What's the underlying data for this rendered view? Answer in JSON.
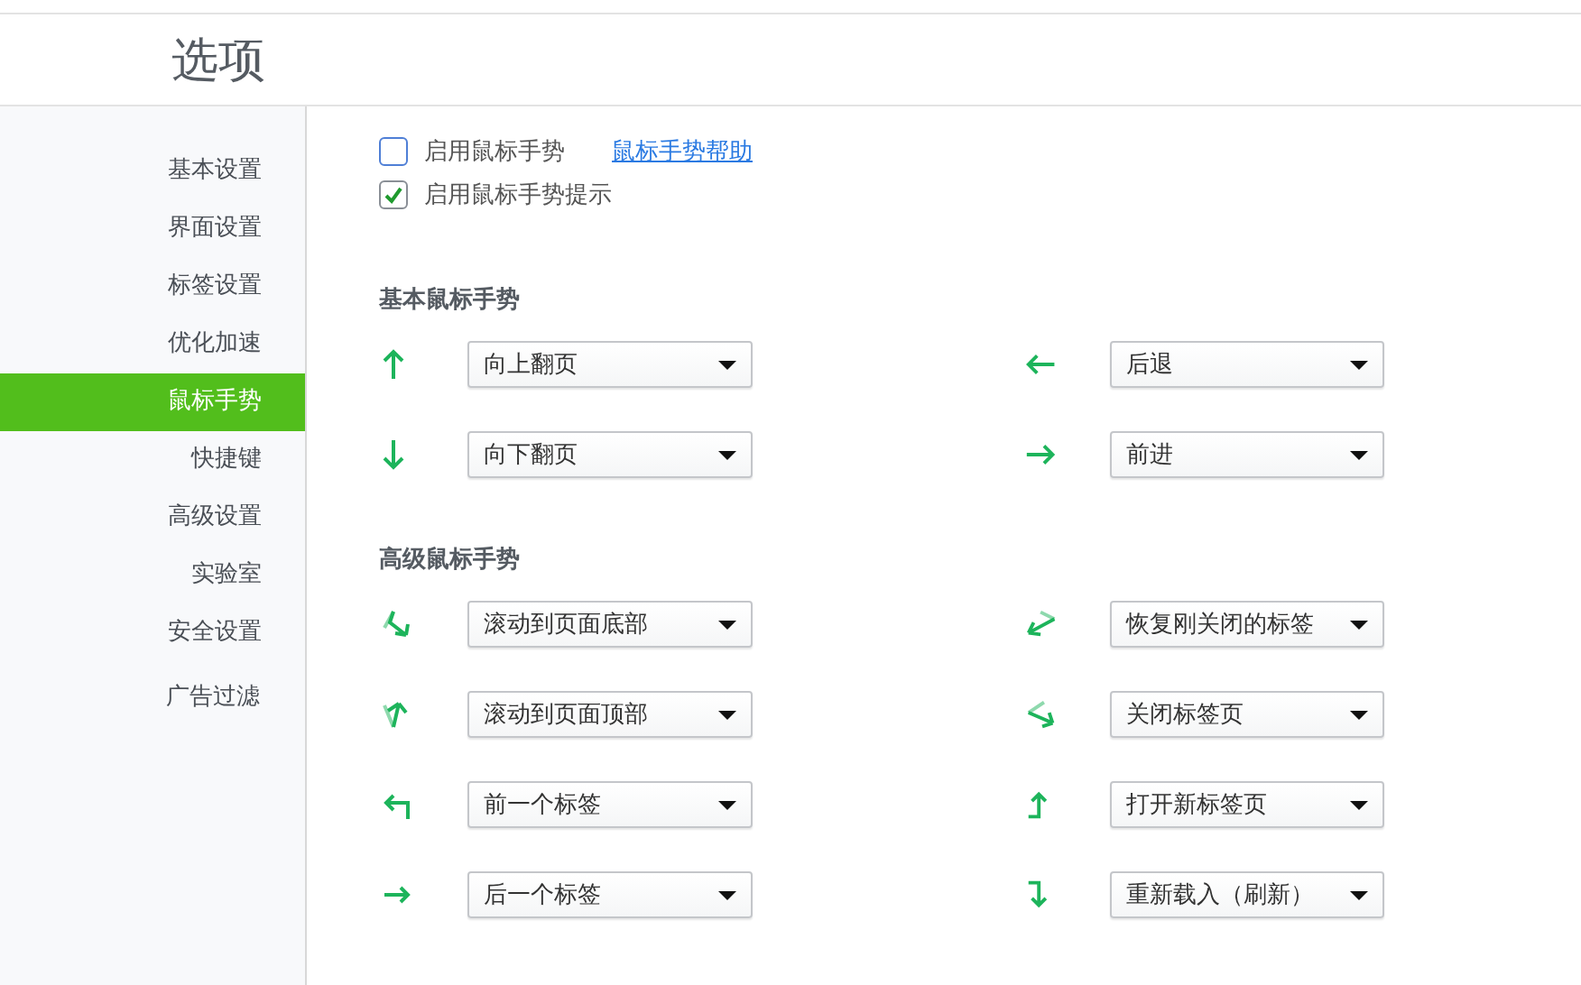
{
  "page_title": "选项",
  "sidebar": {
    "items": [
      {
        "label": "基本设置",
        "selected": false
      },
      {
        "label": "界面设置",
        "selected": false
      },
      {
        "label": "标签设置",
        "selected": false
      },
      {
        "label": "优化加速",
        "selected": false
      },
      {
        "label": "鼠标手势",
        "selected": true
      },
      {
        "label": "快捷键",
        "selected": false
      },
      {
        "label": "高级设置",
        "selected": false
      },
      {
        "label": "实验室",
        "selected": false
      },
      {
        "label": "安全设置",
        "selected": false
      },
      {
        "label": "广告过滤",
        "selected": false
      }
    ]
  },
  "options": [
    {
      "label": "启用鼠标手势",
      "checked": false,
      "link": "鼠标手势帮助"
    },
    {
      "label": "启用鼠标手势提示",
      "checked": true
    }
  ],
  "sections": [
    {
      "title": "基本鼠标手势",
      "gestures": [
        {
          "kind": "up",
          "action": "向上翻页"
        },
        {
          "kind": "left",
          "action": "后退"
        },
        {
          "kind": "down",
          "action": "向下翻页"
        },
        {
          "kind": "right",
          "action": "前进"
        }
      ]
    },
    {
      "title": "高级鼠标手势",
      "gestures": [
        {
          "kind": "zigzag-down",
          "action": "滚动到页面底部"
        },
        {
          "kind": "zigzag-left",
          "action": "恢复刚关闭的标签"
        },
        {
          "kind": "zigzag-up",
          "action": "滚动到页面顶部"
        },
        {
          "kind": "zigzag-right",
          "action": "关闭标签页"
        },
        {
          "kind": "turn-left",
          "action": "前一个标签"
        },
        {
          "kind": "turn-up",
          "action": "打开新标签页"
        },
        {
          "kind": "turn-right",
          "action": "后一个标签"
        },
        {
          "kind": "turn-down",
          "action": "重新载入（刷新）"
        }
      ]
    }
  ]
}
